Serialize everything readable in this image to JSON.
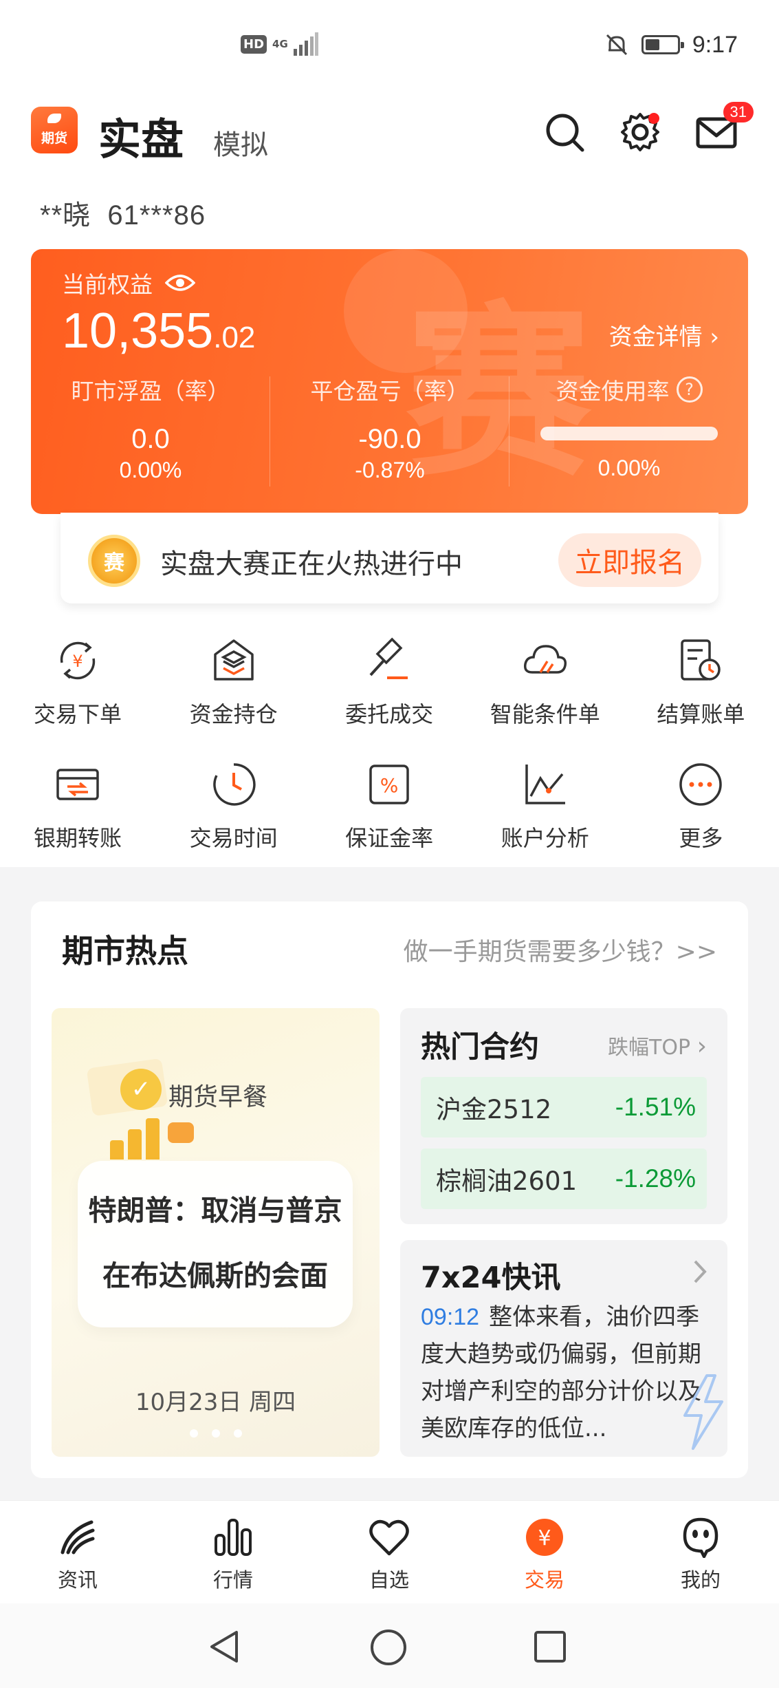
{
  "status_bar": {
    "hd": "HD",
    "network": "4G",
    "time": "9:17"
  },
  "header": {
    "logo_text": "期货",
    "tab_real": "实盘",
    "tab_sim": "模拟",
    "mail_badge": "31"
  },
  "account": {
    "name_masked": "**晓",
    "id_masked": "61***86"
  },
  "equity": {
    "label": "当前权益",
    "value_int": "10,355",
    "value_dec": ".02",
    "detail_link": "资金详情",
    "deco": "赛",
    "cols": [
      {
        "label": "盯市浮盈（率）",
        "v1": "0.0",
        "v2": "0.00%"
      },
      {
        "label": "平仓盈亏（率）",
        "v1": "-90.0",
        "v2": "-0.87%"
      },
      {
        "label": "资金使用率",
        "v2": "0.00%"
      }
    ]
  },
  "contest": {
    "medal": "赛",
    "text": "实盘大赛正在火热进行中",
    "button": "立即报名"
  },
  "grid": [
    {
      "icon": "exchange-yen-icon",
      "label": "交易下单"
    },
    {
      "icon": "stack-house-icon",
      "label": "资金持仓"
    },
    {
      "icon": "gavel-icon",
      "label": "委托成交"
    },
    {
      "icon": "cloud-icon",
      "label": "智能条件单"
    },
    {
      "icon": "statement-icon",
      "label": "结算账单"
    },
    {
      "icon": "card-transfer-icon",
      "label": "银期转账"
    },
    {
      "icon": "clock-icon",
      "label": "交易时间"
    },
    {
      "icon": "percent-icon",
      "label": "保证金率"
    },
    {
      "icon": "line-chart-icon",
      "label": "账户分析"
    },
    {
      "icon": "more-icon",
      "label": "更多"
    }
  ],
  "hot": {
    "title": "期市热点",
    "link": "做一手期货需要多少钱？>>",
    "breakfast": {
      "tag": "期货早餐",
      "headline_1": "特朗普：取消与普京",
      "headline_2": "在布达佩斯的会面",
      "date": "10月23日 周四"
    },
    "contracts": {
      "title": "热门合约",
      "top_link": "跌幅TOP",
      "items": [
        {
          "name": "沪金2512",
          "change": "-1.51%"
        },
        {
          "name": "棕榈油2601",
          "change": "-1.28%"
        }
      ]
    },
    "flash": {
      "title": "7x24快讯",
      "time": "09:12",
      "text": "整体来看，油价四季度大趋势或仍偏弱，但前期对增产利空的部分计价以及美欧库存的低位..."
    }
  },
  "nav": [
    {
      "icon": "news-icon",
      "label": "资讯"
    },
    {
      "icon": "bar-chart-icon",
      "label": "行情"
    },
    {
      "icon": "heart-icon",
      "label": "自选"
    },
    {
      "icon": "trade-yen-icon",
      "label": "交易"
    },
    {
      "icon": "ghost-icon",
      "label": "我的"
    }
  ],
  "colors": {
    "accent": "#ff5a1a",
    "down_green": "#0b9a36",
    "flash_time_blue": "#2f7de1"
  }
}
